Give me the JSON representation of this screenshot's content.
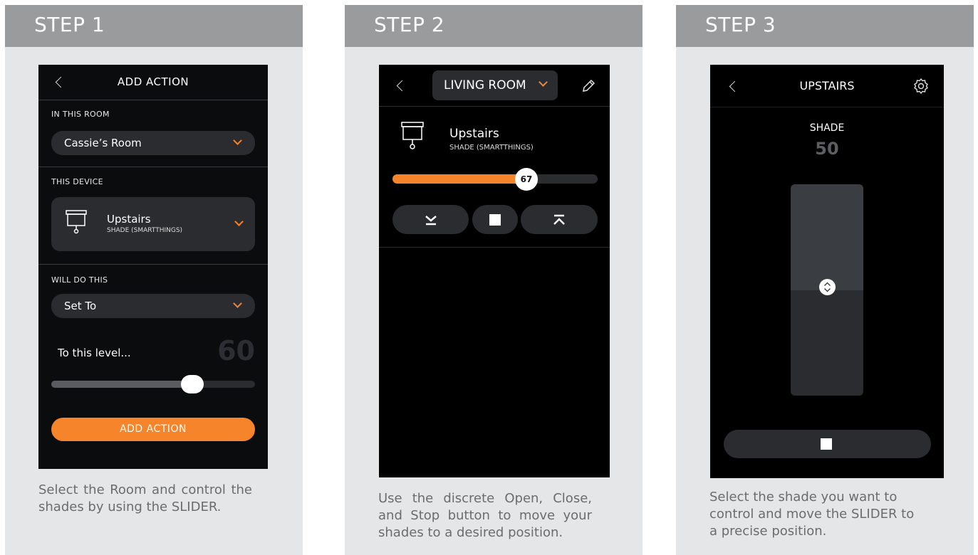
{
  "colors": {
    "accent": "#f5842b",
    "header": "#9a9b9d",
    "card": "#e5e6e8",
    "surface": "#2a2c30"
  },
  "steps": [
    {
      "title": "STEP 1",
      "caption": "Select the Room and control the shades by using the SLIDER.",
      "screen": {
        "title": "ADD ACTION",
        "room_label": "IN THIS ROOM",
        "room_value": "Cassie’s Room",
        "device_label": "THIS DEVICE",
        "device_name": "Upstairs",
        "device_type": "SHADE (SMARTTHINGS)",
        "action_label": "WILL DO THIS",
        "action_value": "Set To",
        "level_label": "To this level...",
        "level_value": "60",
        "slider_level": 0.69,
        "button_label": "ADD ACTION",
        "icons": [
          "back-icon",
          "chevron-down-icon",
          "shade-icon"
        ]
      }
    },
    {
      "title": "STEP 2",
      "caption": "Use the discrete Open, Close, and Stop button to move your shades to a desired position.",
      "screen": {
        "room_selector": "LIVING ROOM",
        "device_name": "Upstairs",
        "device_type": "SHADE (SMARTTHINGS)",
        "slider_value": "67",
        "slider_level": 0.67,
        "icons": [
          "back-icon",
          "chevron-down-icon",
          "pencil-icon",
          "shade-icon",
          "close-shade-icon",
          "stop-icon",
          "open-shade-icon"
        ]
      }
    },
    {
      "title": "STEP 3",
      "caption": "Select the shade you want to control and move the SLIDER to a precise position.",
      "screen": {
        "title": "UPSTAIRS",
        "shade_label": "SHADE",
        "shade_value": "50",
        "shade_level": 0.5,
        "icons": [
          "back-icon",
          "gear-icon",
          "up-down-icon",
          "stop-icon"
        ]
      }
    }
  ]
}
